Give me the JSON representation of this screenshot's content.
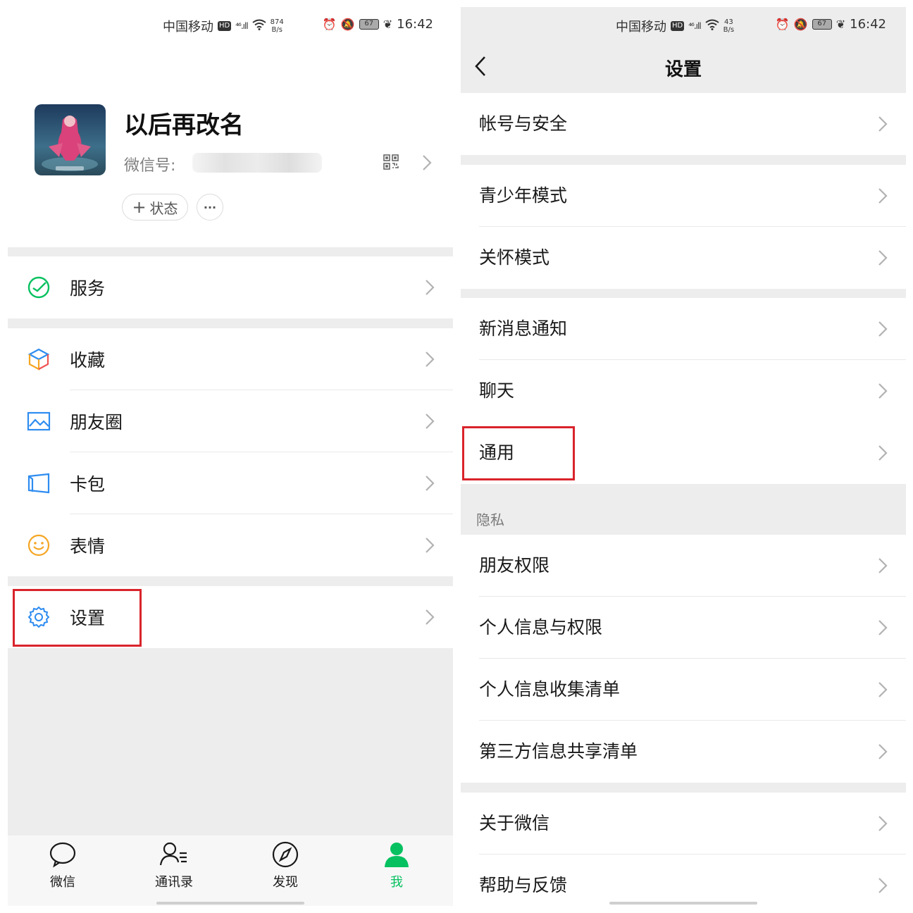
{
  "left": {
    "status_bar": {
      "carrier": "中国移动",
      "hd": "HD",
      "signal": "⁴⁶.ıll",
      "speed_value": "874",
      "speed_unit": "B/s",
      "battery": "67",
      "time": "16:42"
    },
    "profile": {
      "nickname": "以后再改名",
      "wechat_id_label": "微信号:",
      "status_button": "状态",
      "status_plus": "+",
      "more_button": "···"
    },
    "menu": {
      "services": "服务",
      "favorites": "收藏",
      "moments": "朋友圈",
      "cards": "卡包",
      "stickers": "表情",
      "settings": "设置"
    },
    "tabs": [
      {
        "label": "微信",
        "icon": "chat-bubble-icon"
      },
      {
        "label": "通讯录",
        "icon": "contacts-icon"
      },
      {
        "label": "发现",
        "icon": "compass-icon"
      },
      {
        "label": "我",
        "icon": "person-icon",
        "active": true
      }
    ]
  },
  "right": {
    "status_bar": {
      "carrier": "中国移动",
      "hd": "HD",
      "signal": "⁴⁶.ıll",
      "speed_value": "43",
      "speed_unit": "B/s",
      "battery": "67",
      "time": "16:42"
    },
    "title": "设置",
    "items": {
      "account_security": "帐号与安全",
      "youth_mode": "青少年模式",
      "care_mode": "关怀模式",
      "notifications": "新消息通知",
      "chat": "聊天",
      "general": "通用",
      "privacy_header": "隐私",
      "friend_permissions": "朋友权限",
      "personal_info_permissions": "个人信息与权限",
      "personal_info_collection": "个人信息收集清单",
      "third_party_sharing": "第三方信息共享清单",
      "about": "关于微信",
      "help_feedback": "帮助与反馈"
    }
  },
  "colors": {
    "accent": "#07c160",
    "highlight": "#d9232b",
    "background": "#ededed"
  }
}
